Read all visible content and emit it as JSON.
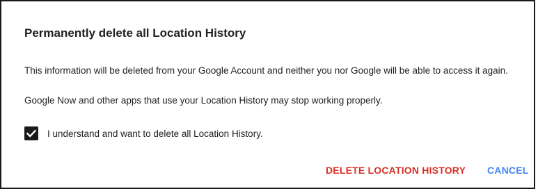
{
  "dialog": {
    "title": "Permanently delete all Location History",
    "info_line": "This information will be deleted from your Google Account and neither you nor Google will be able to access it again.",
    "warning_line": "Google Now and other apps that use your Location History may stop working properly.",
    "confirm_checkbox": {
      "label": "I understand and want to delete all Location History.",
      "checked": true
    },
    "actions": {
      "delete_label": "DELETE LOCATION HISTORY",
      "cancel_label": "CANCEL"
    }
  },
  "colors": {
    "delete": "#d93025",
    "cancel": "#4285f4",
    "checkbox": "#1a1a1a"
  },
  "icons": {
    "checkbox": "check-icon"
  }
}
